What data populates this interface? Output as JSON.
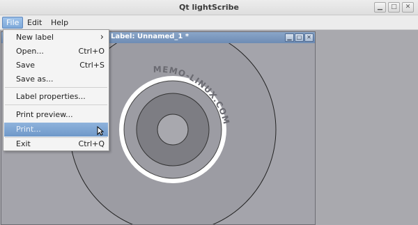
{
  "window": {
    "title": "Qt lightScribe"
  },
  "menubar": {
    "items": [
      {
        "label": "File",
        "active": true
      },
      {
        "label": "Edit"
      },
      {
        "label": "Help"
      }
    ]
  },
  "file_menu": {
    "items": [
      {
        "label": "New label",
        "submenu": true
      },
      {
        "label": "Open...",
        "shortcut": "Ctrl+O"
      },
      {
        "label": "Save",
        "shortcut": "Ctrl+S"
      },
      {
        "label": "Save as..."
      },
      {
        "separator": true
      },
      {
        "label": "Label properties..."
      },
      {
        "separator": true
      },
      {
        "label": "Print preview..."
      },
      {
        "label": "Print...",
        "highlighted": true
      },
      {
        "separator": true
      },
      {
        "label": "Exit",
        "shortcut": "Ctrl+Q"
      }
    ]
  },
  "child_window": {
    "title": "Label: Unnamed_1 *"
  },
  "label_preview": {
    "watermark": "MEMO-LINUX.COM"
  },
  "colors": {
    "menu_highlight": "#7ea9d9",
    "child_titlebar": "#7b97bf",
    "mdi_background": "#a9a9ae"
  }
}
